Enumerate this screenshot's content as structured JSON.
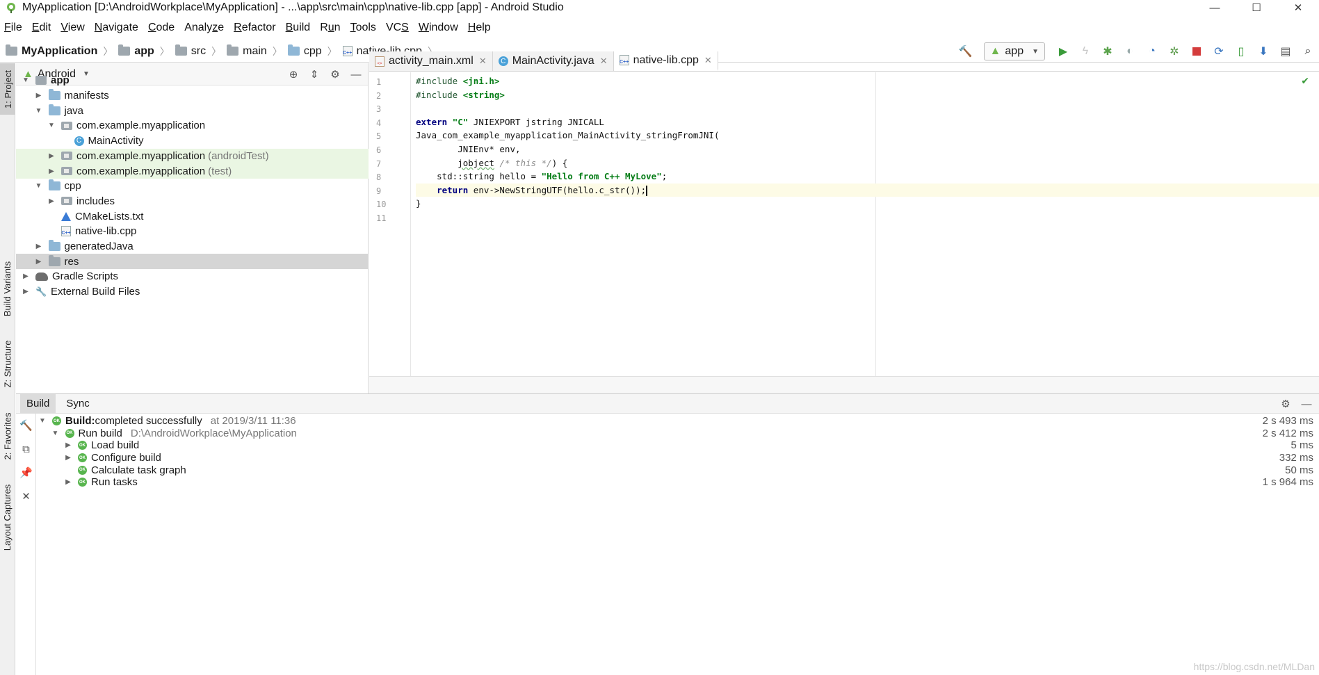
{
  "window": {
    "title": "MyApplication [D:\\AndroidWorkplace\\MyApplication] - ...\\app\\src\\main\\cpp\\native-lib.cpp [app] - Android Studio",
    "minimize": "—",
    "maximize": "☐",
    "close": "✕"
  },
  "menu": [
    {
      "u": "F",
      "rest": "ile"
    },
    {
      "u": "E",
      "rest": "dit"
    },
    {
      "u": "V",
      "rest": "iew"
    },
    {
      "u": "N",
      "rest": "avigate"
    },
    {
      "u": "C",
      "rest": "ode"
    },
    {
      "pre": "Analy",
      "u": "z",
      "rest": "e"
    },
    {
      "u": "R",
      "rest": "efactor"
    },
    {
      "u": "B",
      "rest": "uild"
    },
    {
      "pre": "R",
      "u": "u",
      "rest": "n"
    },
    {
      "u": "T",
      "rest": "ools"
    },
    {
      "pre": "VC",
      "u": "S",
      "rest": ""
    },
    {
      "u": "W",
      "rest": "indow"
    },
    {
      "u": "H",
      "rest": "elp"
    }
  ],
  "breadcrumbs": [
    "MyApplication",
    "app",
    "src",
    "main",
    "cpp",
    "native-lib.cpp"
  ],
  "run_config": "app",
  "project_panel": {
    "view": "Android",
    "tree": [
      {
        "label": "app",
        "suffix": "",
        "depth": 0,
        "arrow": "▼",
        "icon": "app",
        "style": "bold"
      },
      {
        "label": "manifests",
        "suffix": "",
        "depth": 1,
        "arrow": "▶",
        "icon": "folder"
      },
      {
        "label": "java",
        "suffix": "",
        "depth": 1,
        "arrow": "▼",
        "icon": "folder"
      },
      {
        "label": "com.example.myapplication",
        "suffix": "",
        "depth": 2,
        "arrow": "▼",
        "icon": "package"
      },
      {
        "label": "MainActivity",
        "suffix": "",
        "depth": 3,
        "arrow": "",
        "icon": "class"
      },
      {
        "label": "com.example.myapplication",
        "suffix": "(androidTest)",
        "depth": 2,
        "arrow": "▶",
        "icon": "package",
        "style": "green"
      },
      {
        "label": "com.example.myapplication",
        "suffix": "(test)",
        "depth": 2,
        "arrow": "▶",
        "icon": "package",
        "style": "green"
      },
      {
        "label": "cpp",
        "suffix": "",
        "depth": 1,
        "arrow": "▼",
        "icon": "folder"
      },
      {
        "label": "includes",
        "suffix": "",
        "depth": 2,
        "arrow": "▶",
        "icon": "package"
      },
      {
        "label": "CMakeLists.txt",
        "suffix": "",
        "depth": 2,
        "arrow": "",
        "icon": "cmake"
      },
      {
        "label": "native-lib.cpp",
        "suffix": "",
        "depth": 2,
        "arrow": "",
        "icon": "cpp"
      },
      {
        "label": "generatedJava",
        "suffix": "",
        "depth": 1,
        "arrow": "▶",
        "icon": "folder"
      },
      {
        "label": "res",
        "suffix": "",
        "depth": 1,
        "arrow": "▶",
        "icon": "folder-grey",
        "style": "selected"
      },
      {
        "label": "Gradle Scripts",
        "suffix": "",
        "depth": 0,
        "arrow": "▶",
        "icon": "gradle"
      },
      {
        "label": "External Build Files",
        "suffix": "",
        "depth": 0,
        "arrow": "▶",
        "icon": "ext"
      }
    ]
  },
  "side_tabs": [
    "1: Project",
    "Build Variants",
    "Z: Structure",
    "2: Favorites",
    "Layout Captures"
  ],
  "editor_tabs": [
    {
      "label": "activity_main.xml",
      "icon": "xml"
    },
    {
      "label": "MainActivity.java",
      "icon": "class"
    },
    {
      "label": "native-lib.cpp",
      "icon": "cpp",
      "active": true
    }
  ],
  "code_lines": [
    "1",
    "2",
    "3",
    "4",
    "5",
    "6",
    "7",
    "8",
    "9",
    "10",
    "11"
  ],
  "build_panel": {
    "tabs": [
      "Build",
      "Sync"
    ],
    "rows": [
      {
        "depth": 0,
        "arrow": "▼",
        "bold": "Build:",
        "label": " completed successfully",
        "extra": "at 2019/3/11 11:36",
        "time": "2 s 493 ms"
      },
      {
        "depth": 1,
        "arrow": "▼",
        "bold": "",
        "label": "Run build",
        "extra": "D:\\AndroidWorkplace\\MyApplication",
        "time": "2 s 412 ms"
      },
      {
        "depth": 2,
        "arrow": "▶",
        "bold": "",
        "label": "Load build",
        "extra": "",
        "time": "5 ms"
      },
      {
        "depth": 2,
        "arrow": "▶",
        "bold": "",
        "label": "Configure build",
        "extra": "",
        "time": "332 ms"
      },
      {
        "depth": 2,
        "arrow": "",
        "bold": "",
        "label": "Calculate task graph",
        "extra": "",
        "time": "50 ms"
      },
      {
        "depth": 2,
        "arrow": "▶",
        "bold": "",
        "label": "Run tasks",
        "extra": "",
        "time": "1 s 964 ms"
      }
    ],
    "ok_badge": "OK"
  },
  "watermark": "https://blog.csdn.net/MLDan"
}
